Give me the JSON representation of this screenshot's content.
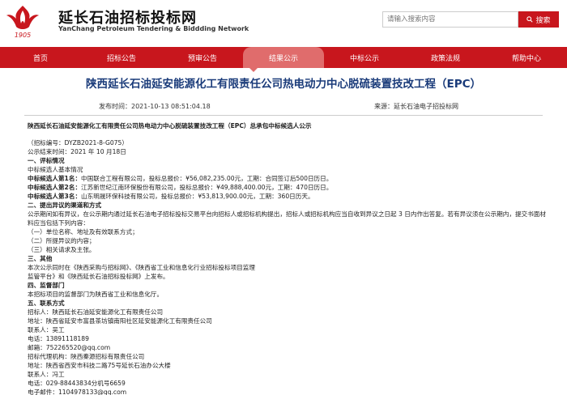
{
  "header": {
    "logo_cn": "延长石油招标投标网",
    "logo_en": "YanChang Petroleum Tendering & Biddding Network",
    "logo_year": "1905",
    "search_placeholder": "请输入搜索内容",
    "search_button": "搜索",
    "brand_color": "#c8161d"
  },
  "nav": {
    "items": [
      "首页",
      "招标公告",
      "预审公告",
      "结果公示",
      "中标公示",
      "政策法规",
      "帮助中心"
    ],
    "active_index": 3
  },
  "article": {
    "title": "陕西延长石油延安能源化工有限责任公司热电动力中心脱硫装置技改工程（EPC）",
    "publish_label": "发布时间：",
    "publish_time": "2021-10-13 08:51:04.18",
    "source_label": "来源：",
    "source": "延长石油电子招投标网",
    "headline": "陕西延长石油延安能源化工有限责任公司热电动力中心脱硫装置技改工程（EPC）总承包中标候选人公示",
    "lines": {
      "l01": "（招标编号：DYZB2021-8-G075）",
      "l02": "公示结束时间：2021 年 10 月18日",
      "l03": "一、评标情况",
      "l04": "中标候选人基本情况",
      "l05a": "中标候选人第1名：",
      "l05b": "中国联合工程有限公司，投标总报价：¥56,082,235.00元，工期：合同签订后500日历日。",
      "l06a": "中标候选人第2名：",
      "l06b": "江苏新世纪江南环保股份有限公司，投标总报价：¥49,888,400.00元，工期：470日历日。",
      "l07a": "中标候选人第3名：",
      "l07b": "山东明晟环保科技有限公司，投标总报价：¥53,813,900.00元，工期：360日历天。",
      "l08": "二、提出异议的渠道和方式",
      "l09": "公示期间如有异议，在公示期内通过延长石油电子招标投标交易平台向招标人或招标机构提出，招标人或招标机构应当自收到异议之日起 3 日内作出答复。若有异议须在公示期内，提交书面材料应当包括下列内容：",
      "l10": "（一）单位名称、地址及有效联系方式；",
      "l11": "（二）所提异议的内容；",
      "l12": "（三）相关请求及主张。",
      "l13": "三、其他",
      "l14": "本次公示同时在《陕西采购与招标网》、《陕西省工业和信息化行业招标投标项目监理",
      "l15": "监管平台》和《陕西延长石油招标投标网》上发布。",
      "l16": "四、监督部门",
      "l17": "本招标项目的监督部门为陕西省工业和信息化厅。",
      "l18": "五、联系方式",
      "l19": "招标人：陕西延长石油延安能源化工有限责任公司",
      "l20": "地址：陕西省延安市富县茶坊镇南阳社区延安能源化工有限责任公司",
      "l21": "联系人：吴工",
      "l22": "电话：13891118189",
      "l23": "邮箱：752265520@qq.com",
      "l24": "招标代理机构：陕西秦源招标有限责任公司",
      "l25": "地址：陕西省西安市科技二路75号延长石油办公大楼",
      "l26": "联系人：冯工",
      "l27": "电话：029-88443834分机号6659",
      "l28": "电子邮件：1104978133@qq.com"
    }
  }
}
